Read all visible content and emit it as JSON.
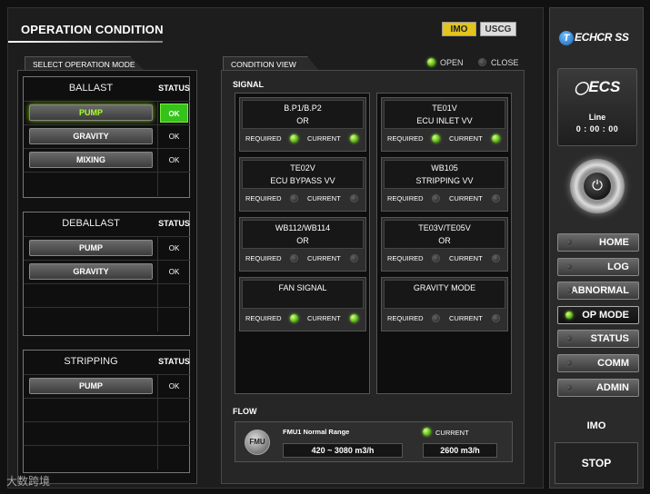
{
  "header": {
    "title": "OPERATION CONDITION",
    "standards": [
      "IMO",
      "USCG"
    ]
  },
  "modes": {
    "tab_label": "SELECT OPERATION MODE",
    "status_header": "STATUS",
    "groups": [
      {
        "title": "BALLAST",
        "rows": [
          {
            "label": "PUMP",
            "status": "OK",
            "active": true
          },
          {
            "label": "GRAVITY",
            "status": "OK"
          },
          {
            "label": "MIXING",
            "status": "OK"
          }
        ]
      },
      {
        "title": "DEBALLAST",
        "rows": [
          {
            "label": "PUMP",
            "status": "OK"
          },
          {
            "label": "GRAVITY",
            "status": "OK"
          }
        ]
      },
      {
        "title": "STRIPPING",
        "rows": [
          {
            "label": "PUMP",
            "status": "OK"
          }
        ]
      }
    ]
  },
  "condition": {
    "tab_label": "CONDITION VIEW",
    "legend": {
      "open": "OPEN",
      "close": "CLOSE"
    },
    "signal_label": "SIGNAL",
    "required_label": "REQUIRED",
    "current_label": "CURRENT",
    "signals_left": [
      {
        "line1": "B.P1/B.P2",
        "line2": "OR",
        "required": true,
        "current": true
      },
      {
        "line1": "TE02V",
        "line2": "ECU BYPASS VV",
        "required": false,
        "current": false
      },
      {
        "line1": "WB112/WB114",
        "line2": "OR",
        "required": false,
        "current": false
      },
      {
        "line1": "FAN SIGNAL",
        "line2": "",
        "required": true,
        "current": true
      }
    ],
    "signals_right": [
      {
        "line1": "TE01V",
        "line2": "ECU INLET VV",
        "required": true,
        "current": true
      },
      {
        "line1": "WB105",
        "line2": "STRIPPING VV",
        "required": false,
        "current": false
      },
      {
        "line1": "TE03V/TE05V",
        "line2": "OR",
        "required": false,
        "current": false
      },
      {
        "line1": "GRAVITY MODE",
        "line2": "",
        "required": false,
        "current": false
      }
    ],
    "flow": {
      "label": "FLOW",
      "icon_text": "FMU",
      "range_label": "FMU1 Normal Range",
      "range_value": "420 ~ 3080 m3/h",
      "current_label": "CURRENT",
      "current_value": "2600 m3/h"
    }
  },
  "sidebar": {
    "brand": "ECHCR SS",
    "brand_initial": "T",
    "ecs_logo": "ECS",
    "line_label": "Line",
    "line_time": "0 : 00 : 00",
    "nav": [
      {
        "label": "HOME",
        "active": false
      },
      {
        "label": "LOG",
        "active": false
      },
      {
        "label": "ABNORMAL",
        "active": false
      },
      {
        "label": "OP MODE",
        "active": true
      },
      {
        "label": "STATUS",
        "active": false
      },
      {
        "label": "COMM",
        "active": false
      },
      {
        "label": "ADMIN",
        "active": false
      }
    ],
    "mode_label": "IMO",
    "stop_label": "STOP"
  },
  "watermark": "大数跨境"
}
